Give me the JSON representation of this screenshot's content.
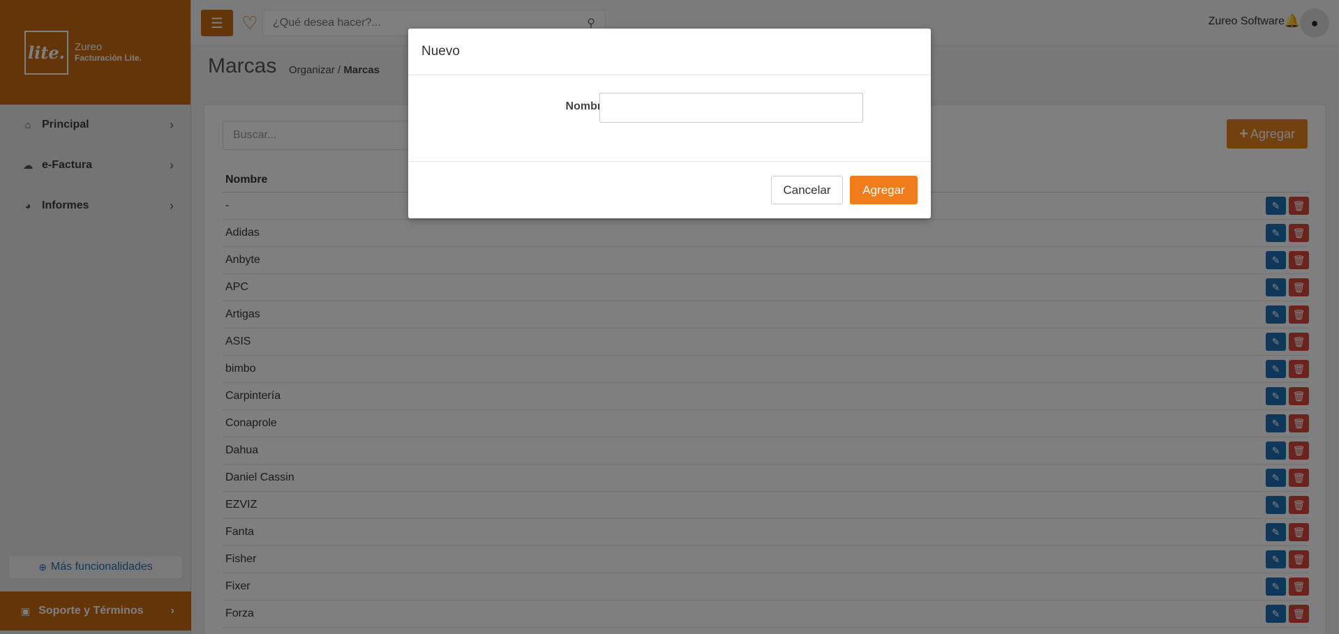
{
  "brand": {
    "logo_mark": "lite.",
    "name": "Zureo",
    "product": "Facturación Lite."
  },
  "sidebar": {
    "items": [
      {
        "label": "Principal",
        "icon": "home-icon"
      },
      {
        "label": "e-Factura",
        "icon": "cloud-icon"
      },
      {
        "label": "Informes",
        "icon": "pie-chart-icon"
      }
    ],
    "more_label": "Más funcionalidades",
    "support_label": "Soporte y Términos"
  },
  "topbar": {
    "search_placeholder": "¿Qué desea hacer?...",
    "user_name": "Zureo Software"
  },
  "page": {
    "title": "Marcas",
    "breadcrumb_parent": "Organizar /",
    "breadcrumb_current": "Marcas"
  },
  "list": {
    "search_placeholder": "Buscar...",
    "add_label": "Agregar",
    "column_header": "Nombre",
    "rows": [
      "-",
      "Adidas",
      "Anbyte",
      "APC",
      "Artigas",
      "ASIS",
      "bimbo",
      "Carpintería",
      "Conaprole",
      "Dahua",
      "Daniel Cassin",
      "EZVIZ",
      "Fanta",
      "Fisher",
      "Fixer",
      "Forza"
    ]
  },
  "modal": {
    "title": "Nuevo",
    "field_label": "Nombre",
    "field_value": "",
    "cancel_label": "Cancelar",
    "add_label": "Agregar"
  },
  "colors": {
    "accent": "#c96a12",
    "button_orange": "#f07c1b",
    "edit_blue": "#1f6fb4",
    "delete_red": "#d9463c"
  }
}
